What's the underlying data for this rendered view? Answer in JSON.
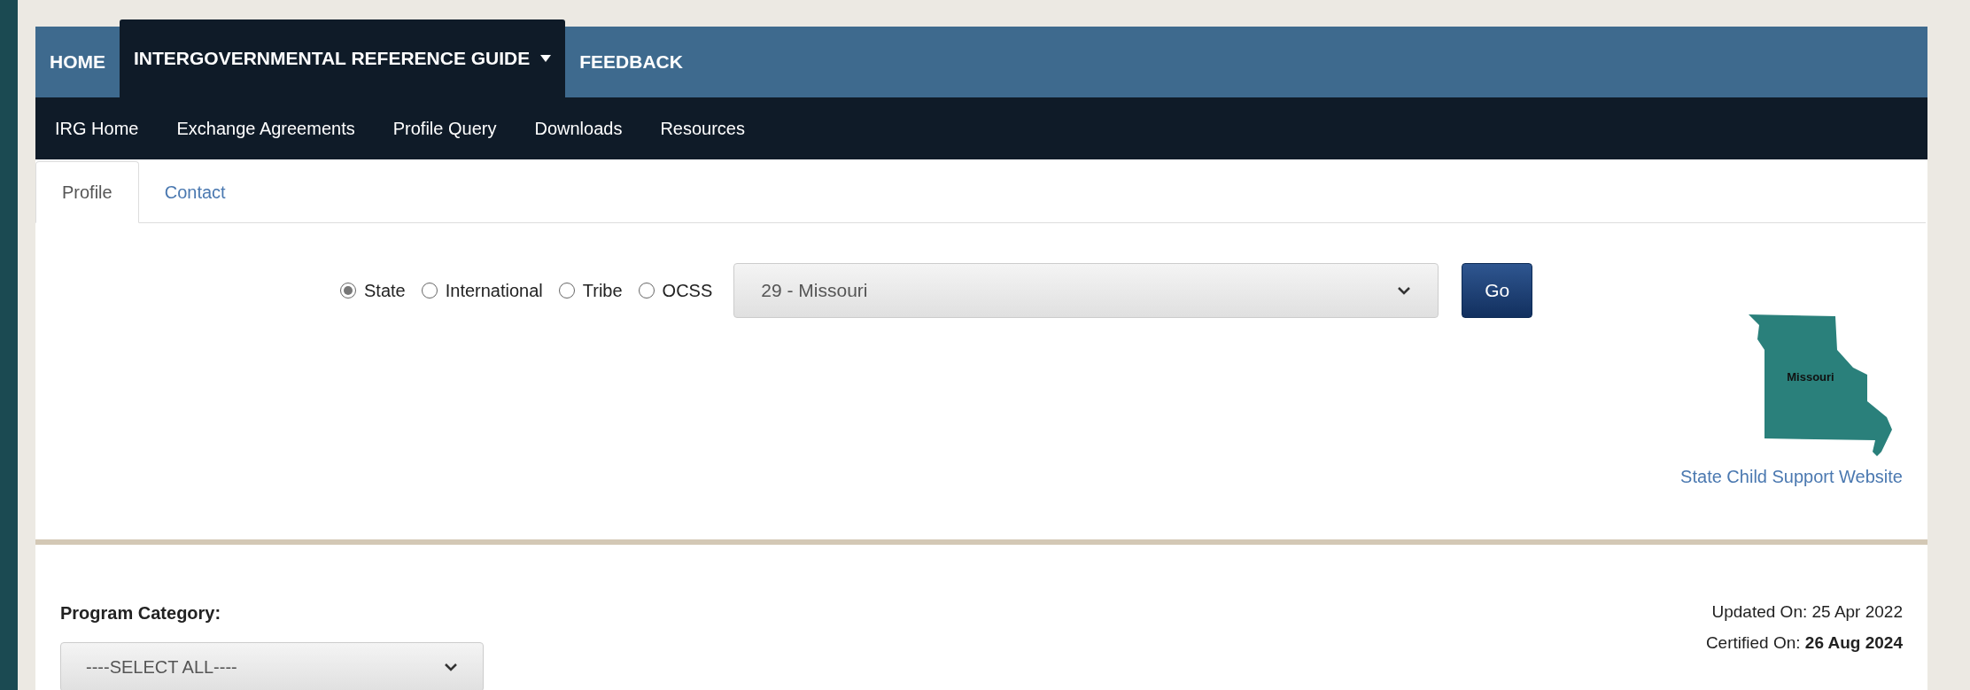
{
  "nav": {
    "items": [
      {
        "label": "HOME",
        "selected": false,
        "has_menu": false
      },
      {
        "label": "INTERGOVERNMENTAL REFERENCE GUIDE",
        "selected": true,
        "has_menu": true
      },
      {
        "label": "FEEDBACK",
        "selected": false,
        "has_menu": false
      }
    ]
  },
  "subnav": [
    "IRG Home",
    "Exchange Agreements",
    "Profile Query",
    "Downloads",
    "Resources"
  ],
  "tabs": [
    {
      "label": "Profile",
      "selected": true
    },
    {
      "label": "Contact",
      "selected": false
    }
  ],
  "search": {
    "options": [
      {
        "label": "State",
        "selected": true
      },
      {
        "label": "International",
        "selected": false
      },
      {
        "label": "Tribe",
        "selected": false
      },
      {
        "label": "OCSS",
        "selected": false
      }
    ],
    "jurisdiction": "29 - Missouri",
    "button": "Go"
  },
  "map": {
    "label": "Missouri"
  },
  "website_link": "State Child Support Website",
  "program_category": {
    "label": "Program Category:",
    "value": "----SELECT ALL----"
  },
  "updated_on": "Updated On: 25 Apr 2022",
  "certified_on": "Certified On: **26 Aug 2024**"
}
